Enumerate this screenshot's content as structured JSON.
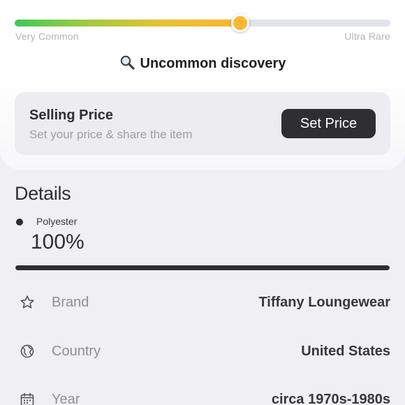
{
  "rarity": {
    "level_fraction": 0.6,
    "min_label": "Very Common",
    "max_label": "Ultra Rare",
    "discovery_text": "Uncommon discovery",
    "icon": "magnifier-icon",
    "colors": {
      "start": "#3ec95a",
      "mid": "#e6c233",
      "end": "#fdb333",
      "track": "#e1e3ee"
    }
  },
  "selling": {
    "title": "Selling Price",
    "subtitle": "Set your price & share the item",
    "button_label": "Set Price"
  },
  "details": {
    "heading": "Details",
    "materials": [
      {
        "name": "Polyester",
        "percent_label": "100%",
        "fraction": 1.0
      }
    ],
    "rows": [
      {
        "icon": "star-icon",
        "label": "Brand",
        "value": "Tiffany Loungewear"
      },
      {
        "icon": "globe-icon",
        "label": "Country",
        "value": "United States"
      },
      {
        "icon": "calendar-icon",
        "label": "Year",
        "value": "circa 1970s-1980s"
      }
    ]
  }
}
